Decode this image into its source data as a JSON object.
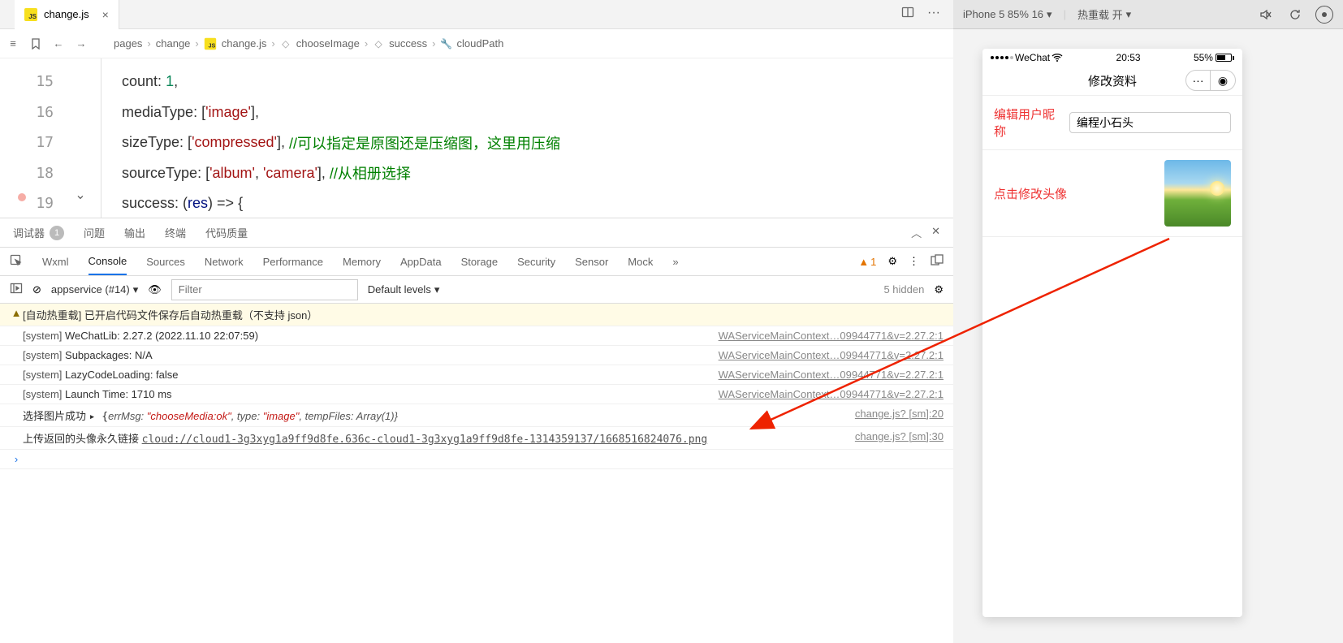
{
  "tab": {
    "filename": "change.js"
  },
  "breadcrumb": [
    "pages",
    "change",
    "change.js",
    "chooseImage",
    "success",
    "cloudPath"
  ],
  "code": {
    "lines": [
      15,
      16,
      17,
      18,
      19
    ],
    "l15": {
      "prop": "count",
      "punct": ": ",
      "val": "1",
      "tail": ","
    },
    "l16": {
      "prop": "mediaType",
      "punct": ": [",
      "str": "'image'",
      "tail": "],"
    },
    "l17": {
      "prop": "sizeType",
      "punct": ": [",
      "str": "'compressed'",
      "tail": "], ",
      "comment": "//可以指定是原图还是压缩图，这里用压缩"
    },
    "l18": {
      "prop": "sourceType",
      "punct": ": [",
      "str1": "'album'",
      "mid": ", ",
      "str2": "'camera'",
      "tail": "], ",
      "comment": "//从相册选择"
    },
    "l19": {
      "prop": "success",
      "punct": ": (",
      "ident": "res",
      "tail": ") => {"
    }
  },
  "panel_tabs": {
    "debugger": "调试器",
    "problems": "问题",
    "output": "输出",
    "terminal": "终端",
    "quality": "代码质量",
    "badge": "1"
  },
  "devtools": {
    "tabs": [
      "Wxml",
      "Console",
      "Sources",
      "Network",
      "Performance",
      "Memory",
      "AppData",
      "Storage",
      "Security",
      "Sensor",
      "Mock"
    ],
    "active": "Console",
    "warn_count": "1"
  },
  "console_toolbar": {
    "ctx": "appservice (#14)",
    "filter_ph": "Filter",
    "levels": "Default levels",
    "hidden": "5 hidden"
  },
  "console": [
    {
      "type": "warn",
      "text": "[自动热重载] 已开启代码文件保存后自动热重载（不支持 json）"
    },
    {
      "type": "sys",
      "tag": "[system]",
      "text": " WeChatLib: 2.27.2 (2022.11.10 22:07:59)",
      "link": "WAServiceMainContext…09944771&v=2.27.2:1"
    },
    {
      "type": "sys",
      "tag": "[system]",
      "text": " Subpackages: N/A",
      "link": "WAServiceMainContext…09944771&v=2.27.2:1"
    },
    {
      "type": "sys",
      "tag": "[system]",
      "text": " LazyCodeLoading: false",
      "link": "WAServiceMainContext…09944771&v=2.27.2:1"
    },
    {
      "type": "sys",
      "tag": "[system]",
      "text": " Launch Time: 1710 ms",
      "link": "WAServiceMainContext…09944771&v=2.27.2:1"
    },
    {
      "type": "log",
      "prefix": "选择图片成功 ",
      "obj_open": "▸ {",
      "p1": "errMsg: ",
      "v1": "\"chooseMedia:ok\"",
      "p2": ", type: ",
      "v2": "\"image\"",
      "p3": ", tempFiles: Array(1)}",
      "link": "change.js? [sm]:20"
    },
    {
      "type": "log",
      "prefix": "上传返回的头像永久链接 ",
      "url": "cloud://cloud1-3g3xyg1a9ff9d8fe.636c-cloud1-3g3xyg1a9ff9d8fe-1314359137/1668516824076.png",
      "link": "change.js? [sm]:30"
    }
  ],
  "top_right": {
    "device": "iPhone 5 85% 16",
    "reload": "热重载 开"
  },
  "simulator": {
    "carrier": "WeChat",
    "time": "20:53",
    "battery": "55%",
    "title": "修改资料",
    "row1_label": "编辑用户昵称",
    "row1_value": "编程小石头",
    "row2_label": "点击修改头像"
  }
}
